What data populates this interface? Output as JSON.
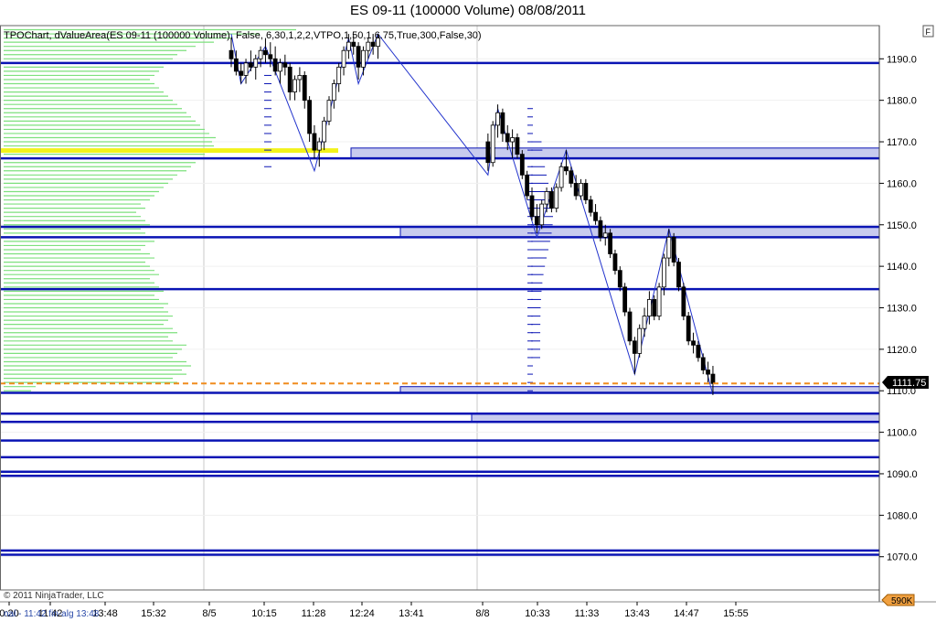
{
  "window": {
    "title": "ES 09-11 (100000 Volume)  08/08/2011",
    "panel_button": "F"
  },
  "indicator": {
    "label": "TPOChart, dValueArea(ES 09-11 (100000 Volume), False, 6,30,1,2,2,VTPO,1,50,1,6.75,True,300,False,30)"
  },
  "footer": {
    "copyright": "© 2011 NinjaTrader, LLC",
    "bottom_left": "nal - 11:42 fin-alg 13:48",
    "volume_badge": "590K"
  },
  "colors": {
    "candle_up": "#ffffff",
    "candle_down": "#000000",
    "zigzag": "#2233cc",
    "level_line": "#0a14b4",
    "zone_fill": "#c8cbee",
    "profile": "#7de07d",
    "poc": "#f2f21a",
    "last_price_line": "#f08c1e",
    "last_price_badge": "#000000"
  },
  "chart_data": {
    "type": "candlestick",
    "ylim": [
      1062,
      1198
    ],
    "y_ticks": [
      1070,
      1080,
      1090,
      1100,
      1110,
      1120,
      1130,
      1140,
      1150,
      1160,
      1170,
      1180,
      1190
    ],
    "x_tick_labels": [
      "0:20",
      "11:42",
      "13:48",
      "15:32",
      "8/5",
      "10:15",
      "11:28",
      "12:24",
      "13:41",
      "8/8",
      "10:33",
      "11:33",
      "13:43",
      "14:47",
      "15:55"
    ],
    "session_breaks": [
      "8/5",
      "8/8"
    ],
    "last_price": 1111.75,
    "last_price_label": "1111.75",
    "horizontal_levels": [
      1189,
      1166,
      1149.5,
      1147,
      1134.5,
      1109.5,
      1104.5,
      1102.5,
      1098,
      1094,
      1090.5,
      1089.5,
      1071.5,
      1070.5
    ],
    "zones": [
      {
        "from": 1166,
        "to": 1168.5,
        "start": "12:24"
      },
      {
        "from": 1147,
        "to": 1149.5,
        "start": "13:41"
      },
      {
        "from": 1109.5,
        "to": 1111,
        "start": "13:41"
      },
      {
        "from": 1102.5,
        "to": 1104.5,
        "start": "8/8"
      }
    ],
    "poc_level": 1168,
    "volume_profile": {
      "low": 1110,
      "step": 1,
      "lengths": [
        30,
        35,
        190,
        185,
        200,
        195,
        205,
        200,
        185,
        190,
        195,
        200,
        185,
        180,
        190,
        185,
        175,
        180,
        185,
        180,
        175,
        180,
        170,
        165,
        175,
        170,
        165,
        160,
        170,
        165,
        160,
        155,
        165,
        160,
        150,
        155,
        165,
        160,
        155,
        150,
        160,
        155,
        150,
        145,
        155,
        150,
        160,
        165,
        170,
        175,
        180,
        185,
        190,
        200,
        205,
        210,
        215,
        220,
        225,
        230,
        228,
        232,
        225,
        220,
        215,
        210,
        205,
        200,
        195,
        190,
        185,
        180,
        175,
        170,
        165,
        160,
        165,
        170,
        175,
        180,
        185,
        190,
        200,
        210,
        230,
        250,
        280,
        320,
        360,
        380,
        380,
        360,
        330,
        300
      ]
    },
    "candles": [
      {
        "o": 1192,
        "h": 1195,
        "l": 1188,
        "c": 1190
      },
      {
        "o": 1190,
        "h": 1192,
        "l": 1186,
        "c": 1187
      },
      {
        "o": 1187,
        "h": 1189,
        "l": 1184,
        "c": 1186
      },
      {
        "o": 1186,
        "h": 1190,
        "l": 1184,
        "c": 1189
      },
      {
        "o": 1189,
        "h": 1192,
        "l": 1187,
        "c": 1188
      },
      {
        "o": 1188,
        "h": 1191,
        "l": 1185,
        "c": 1190
      },
      {
        "o": 1190,
        "h": 1193,
        "l": 1188,
        "c": 1192
      },
      {
        "o": 1192,
        "h": 1195,
        "l": 1189,
        "c": 1191
      },
      {
        "o": 1191,
        "h": 1194,
        "l": 1188,
        "c": 1190
      },
      {
        "o": 1190,
        "h": 1193,
        "l": 1186,
        "c": 1187
      },
      {
        "o": 1187,
        "h": 1190,
        "l": 1184,
        "c": 1189
      },
      {
        "o": 1189,
        "h": 1191,
        "l": 1186,
        "c": 1188
      },
      {
        "o": 1188,
        "h": 1189,
        "l": 1180,
        "c": 1182
      },
      {
        "o": 1182,
        "h": 1186,
        "l": 1180,
        "c": 1185
      },
      {
        "o": 1185,
        "h": 1188,
        "l": 1182,
        "c": 1186
      },
      {
        "o": 1186,
        "h": 1187,
        "l": 1178,
        "c": 1180
      },
      {
        "o": 1180,
        "h": 1181,
        "l": 1170,
        "c": 1172
      },
      {
        "o": 1172,
        "h": 1174,
        "l": 1166,
        "c": 1168
      },
      {
        "o": 1168,
        "h": 1171,
        "l": 1164,
        "c": 1170
      },
      {
        "o": 1170,
        "h": 1176,
        "l": 1168,
        "c": 1175
      },
      {
        "o": 1175,
        "h": 1181,
        "l": 1174,
        "c": 1180
      },
      {
        "o": 1180,
        "h": 1185,
        "l": 1178,
        "c": 1184
      },
      {
        "o": 1184,
        "h": 1189,
        "l": 1182,
        "c": 1188
      },
      {
        "o": 1188,
        "h": 1193,
        "l": 1186,
        "c": 1192
      },
      {
        "o": 1192,
        "h": 1196,
        "l": 1190,
        "c": 1194
      },
      {
        "o": 1194,
        "h": 1196,
        "l": 1191,
        "c": 1193
      },
      {
        "o": 1193,
        "h": 1194,
        "l": 1185,
        "c": 1188
      },
      {
        "o": 1188,
        "h": 1193,
        "l": 1186,
        "c": 1192
      },
      {
        "o": 1192,
        "h": 1195,
        "l": 1190,
        "c": 1194
      },
      {
        "o": 1194,
        "h": 1196,
        "l": 1191,
        "c": 1193
      },
      {
        "o": 1193,
        "h": 1196,
        "l": 1190,
        "c": 1195
      },
      {
        "o": 1170,
        "h": 1172,
        "l": 1163,
        "c": 1165
      },
      {
        "o": 1165,
        "h": 1175,
        "l": 1164,
        "c": 1174
      },
      {
        "o": 1174,
        "h": 1179,
        "l": 1171,
        "c": 1177
      },
      {
        "o": 1177,
        "h": 1178,
        "l": 1170,
        "c": 1172
      },
      {
        "o": 1172,
        "h": 1174,
        "l": 1168,
        "c": 1170
      },
      {
        "o": 1170,
        "h": 1173,
        "l": 1166,
        "c": 1171
      },
      {
        "o": 1171,
        "h": 1172,
        "l": 1166,
        "c": 1167
      },
      {
        "o": 1167,
        "h": 1168,
        "l": 1161,
        "c": 1162
      },
      {
        "o": 1162,
        "h": 1163,
        "l": 1156,
        "c": 1157
      },
      {
        "o": 1157,
        "h": 1159,
        "l": 1151,
        "c": 1152
      },
      {
        "o": 1152,
        "h": 1155,
        "l": 1148,
        "c": 1150
      },
      {
        "o": 1150,
        "h": 1156,
        "l": 1149,
        "c": 1155
      },
      {
        "o": 1155,
        "h": 1159,
        "l": 1153,
        "c": 1158
      },
      {
        "o": 1158,
        "h": 1159,
        "l": 1153,
        "c": 1154
      },
      {
        "o": 1154,
        "h": 1160,
        "l": 1153,
        "c": 1159
      },
      {
        "o": 1159,
        "h": 1165,
        "l": 1158,
        "c": 1164
      },
      {
        "o": 1164,
        "h": 1168,
        "l": 1162,
        "c": 1163
      },
      {
        "o": 1163,
        "h": 1164,
        "l": 1159,
        "c": 1160
      },
      {
        "o": 1160,
        "h": 1162,
        "l": 1156,
        "c": 1157
      },
      {
        "o": 1157,
        "h": 1161,
        "l": 1156,
        "c": 1160
      },
      {
        "o": 1160,
        "h": 1161,
        "l": 1155,
        "c": 1156
      },
      {
        "o": 1156,
        "h": 1157,
        "l": 1152,
        "c": 1153
      },
      {
        "o": 1153,
        "h": 1155,
        "l": 1150,
        "c": 1151
      },
      {
        "o": 1151,
        "h": 1152,
        "l": 1146,
        "c": 1147
      },
      {
        "o": 1147,
        "h": 1150,
        "l": 1145,
        "c": 1148
      },
      {
        "o": 1148,
        "h": 1149,
        "l": 1142,
        "c": 1143
      },
      {
        "o": 1143,
        "h": 1144,
        "l": 1138,
        "c": 1139
      },
      {
        "o": 1139,
        "h": 1140,
        "l": 1134,
        "c": 1135
      },
      {
        "o": 1135,
        "h": 1136,
        "l": 1128,
        "c": 1129
      },
      {
        "o": 1129,
        "h": 1130,
        "l": 1121,
        "c": 1122
      },
      {
        "o": 1122,
        "h": 1123,
        "l": 1114,
        "c": 1119
      },
      {
        "o": 1119,
        "h": 1126,
        "l": 1118,
        "c": 1125
      },
      {
        "o": 1125,
        "h": 1130,
        "l": 1123,
        "c": 1128
      },
      {
        "o": 1128,
        "h": 1134,
        "l": 1126,
        "c": 1132
      },
      {
        "o": 1132,
        "h": 1133,
        "l": 1127,
        "c": 1128
      },
      {
        "o": 1128,
        "h": 1136,
        "l": 1127,
        "c": 1135
      },
      {
        "o": 1135,
        "h": 1143,
        "l": 1133,
        "c": 1142
      },
      {
        "o": 1142,
        "h": 1149,
        "l": 1140,
        "c": 1147
      },
      {
        "o": 1147,
        "h": 1148,
        "l": 1140,
        "c": 1141
      },
      {
        "o": 1141,
        "h": 1142,
        "l": 1134,
        "c": 1135
      },
      {
        "o": 1135,
        "h": 1136,
        "l": 1127,
        "c": 1128
      },
      {
        "o": 1128,
        "h": 1129,
        "l": 1121,
        "c": 1122
      },
      {
        "o": 1122,
        "h": 1124,
        "l": 1119,
        "c": 1121
      },
      {
        "o": 1121,
        "h": 1122,
        "l": 1117,
        "c": 1118
      },
      {
        "o": 1118,
        "h": 1119,
        "l": 1114,
        "c": 1115
      },
      {
        "o": 1115,
        "h": 1117,
        "l": 1112,
        "c": 1114
      },
      {
        "o": 1114,
        "h": 1116,
        "l": 1109,
        "c": 1111.75
      }
    ],
    "zigzag": [
      1196,
      1184,
      1193,
      1163,
      1195,
      1184,
      1196,
      1162,
      1178,
      1147,
      1168,
      1114,
      1149,
      1109
    ]
  }
}
